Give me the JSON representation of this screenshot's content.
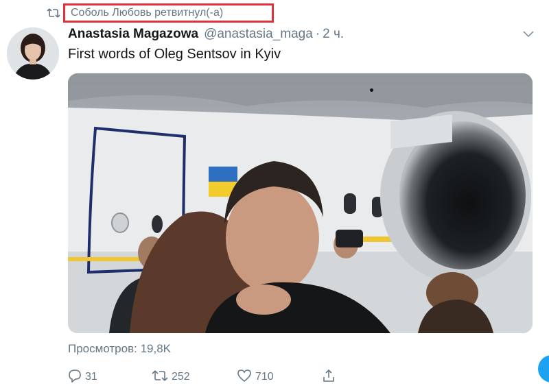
{
  "retweet": {
    "icon": "retweet-icon",
    "text": "Соболь Любовь ретвитнул(-а)",
    "highlight_color": "#e0313a"
  },
  "tweet": {
    "author_name": "Anastasia Magazowa",
    "author_handle": "@anastasia_maga",
    "time_separator": "·",
    "time": "2 ч.",
    "text": "First words of Oleg Sentsov in Kyiv",
    "media": {
      "type": "video-frame",
      "label": "Video frame: man in black shirt embracing a woman near an aircraft with a Ukrainian flag"
    },
    "views": "Просмотров: 19,8K"
  },
  "actions": {
    "reply": {
      "icon": "reply-icon",
      "count": "31"
    },
    "retweet": {
      "icon": "retweet-icon",
      "count": "252"
    },
    "like": {
      "icon": "heart-icon",
      "count": "710"
    },
    "share": {
      "icon": "share-icon"
    }
  },
  "colors": {
    "secondary_text": "#657786",
    "primary_text": "#14171a",
    "accent": "#1da1f2"
  }
}
